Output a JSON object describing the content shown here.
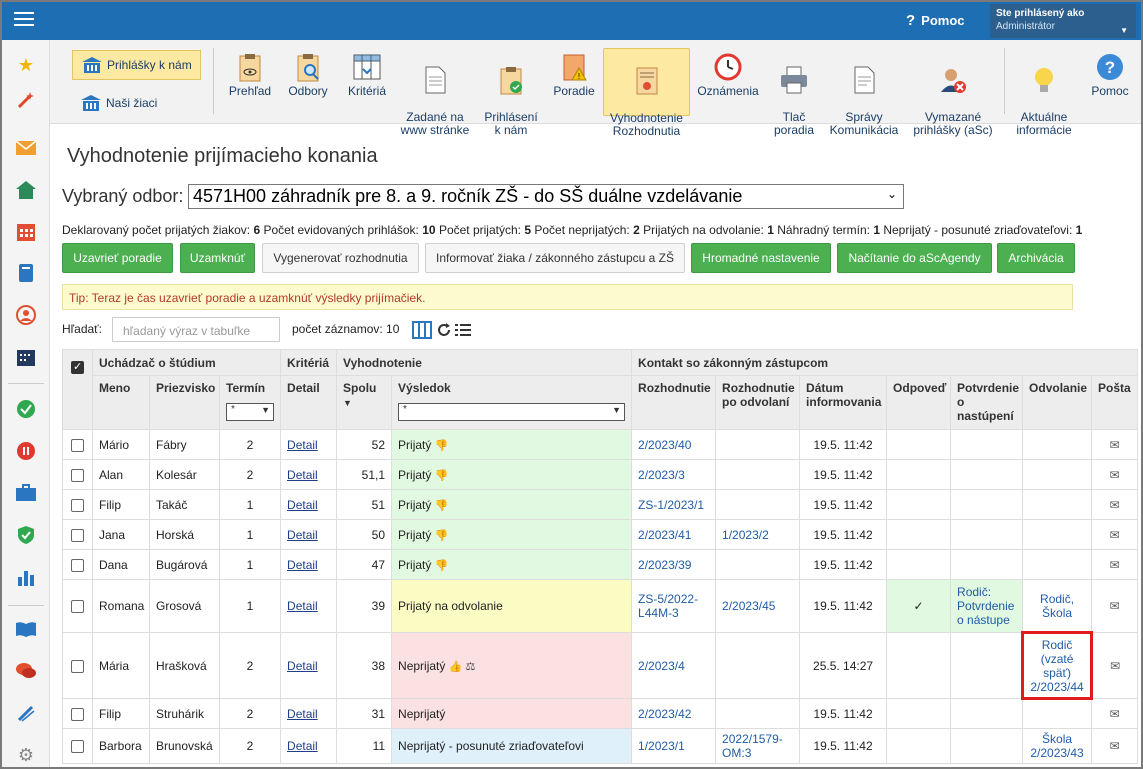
{
  "topbar": {
    "help_label": "Pomoc",
    "user_line1": "Ste prihlásený ako",
    "user_line2": "Administrátor"
  },
  "sidebar": {
    "icons": [
      "star-icon",
      "magic-wand-icon",
      "envelope-icon",
      "home-icon",
      "calendar-icon",
      "book-icon",
      "person-icon",
      "timetable-icon",
      "checkmark-icon",
      "pause-icon",
      "briefcase-icon",
      "shield-icon",
      "chart-icon",
      "open-book-icon",
      "chat-icon",
      "pen-icon",
      "gear-icon"
    ]
  },
  "toolbar": {
    "left": [
      {
        "label": "Prihlášky k nám",
        "active": true
      },
      {
        "label": "Naši žiaci",
        "active": false
      }
    ],
    "items": [
      {
        "label": "Prehľad",
        "icon": "clipboard-eye-icon"
      },
      {
        "label": "Odbory",
        "icon": "clipboard-search-icon"
      },
      {
        "label": "Kritériá",
        "icon": "table-download-icon"
      },
      {
        "label": "Zadané na\nwww stránke",
        "icon": "document-icon"
      },
      {
        "label": "Prihlásení\nk nám",
        "icon": "clipboard-check-icon"
      },
      {
        "label": "Poradie",
        "icon": "warning-doc-icon"
      },
      {
        "label": "Vyhodnotenie\nRozhodnutia",
        "icon": "certificate-icon",
        "active": true
      },
      {
        "label": "Oznámenia",
        "icon": "clock-icon"
      },
      {
        "label": "Tlač\nporadia",
        "icon": "printer-icon"
      },
      {
        "label": "Správy\nKomunikácia",
        "icon": "message-doc-icon"
      },
      {
        "label": "Vymazané\nprihlášky (aSc)",
        "icon": "user-delete-icon"
      },
      {
        "label": "Aktuálne\ninformácie",
        "icon": "lightbulb-icon"
      },
      {
        "label": "Pomoc",
        "icon": "help-icon"
      }
    ]
  },
  "page": {
    "title": "Vyhodnotenie prijímacieho konania",
    "odbor_label": "Vybraný odbor:",
    "odbor_value": "4571H00 záhradník pre 8. a 9. ročník ZŠ - do SŠ duálne vzdelávanie",
    "stats": [
      {
        "label": "Deklarovaný počet prijatých žiakov:",
        "value": "6"
      },
      {
        "label": "Počet evidovaných prihlášok:",
        "value": "10"
      },
      {
        "label": "Počet prijatých:",
        "value": "5"
      },
      {
        "label": "Počet neprijatých:",
        "value": "2"
      },
      {
        "label": "Prijatých na odvolanie:",
        "value": "1"
      },
      {
        "label": "Náhradný termín:",
        "value": "1"
      },
      {
        "label": "Neprijatý - posunuté zriaďovateľovi:",
        "value": "1"
      }
    ],
    "buttons": [
      {
        "label": "Uzavrieť poradie",
        "style": "green"
      },
      {
        "label": "Uzamknúť",
        "style": "green"
      },
      {
        "label": "Vygenerovať rozhodnutia",
        "style": "gray"
      },
      {
        "label": "Informovať žiaka / zákonného zástupcu a ZŠ",
        "style": "gray"
      },
      {
        "label": "Hromadné nastavenie",
        "style": "green"
      },
      {
        "label": "Načítanie do aScAgendy",
        "style": "green"
      },
      {
        "label": "Archivácia",
        "style": "green"
      }
    ],
    "tip": "Tip: Teraz je čas uzavrieť poradie a uzamknúť výsledky prijímačiek.",
    "search_label": "Hľadať:",
    "search_placeholder": "hľadaný výraz v tabuľke",
    "count_label": "počet záznamov: 10"
  },
  "table": {
    "groups": {
      "applicant": "Uchádzač o štúdium",
      "criteria": "Kritériá",
      "evaluation": "Vyhodnotenie",
      "contact": "Kontakt so zákonným zástupcom"
    },
    "columns": {
      "meno": "Meno",
      "priezvisko": "Priezvisko",
      "termin": "Termín",
      "detail": "Detail",
      "spolu": "Spolu",
      "vysledok": "Výsledok",
      "rozhodnutie": "Rozhodnutie",
      "rozhodnutie_odv": "Rozhodnutie po odvolaní",
      "datum": "Dátum informovania",
      "odpoved": "Odpoveď",
      "potvrdenie": "Potvrdenie o nastúpení",
      "odvolanie": "Odvolanie",
      "posta": "Pošta"
    },
    "filter_termin": "*",
    "filter_vysledok": "*",
    "sort_indicator": "▼",
    "rows": [
      {
        "meno": "Mário",
        "priezvisko": "Fábry",
        "termin": "2",
        "detail": "Detail",
        "spolu": "52",
        "vysledok": "Prijatý",
        "thumbs": "👎",
        "rbg": "green",
        "rozhodnutie": "2/2023/40",
        "rozhodnutie_odv": "",
        "datum": "19.5. 11:42",
        "odpoved": "",
        "potvrdenie": "",
        "odvolanie": ""
      },
      {
        "meno": "Alan",
        "priezvisko": "Kolesár",
        "termin": "2",
        "detail": "Detail",
        "spolu": "51,1",
        "vysledok": "Prijatý",
        "thumbs": "👎",
        "rbg": "green",
        "rozhodnutie": "2/2023/3",
        "rozhodnutie_odv": "",
        "datum": "19.5. 11:42",
        "odpoved": "",
        "potvrdenie": "",
        "odvolanie": ""
      },
      {
        "meno": "Filip",
        "priezvisko": "Takáč",
        "termin": "1",
        "detail": "Detail",
        "spolu": "51",
        "vysledok": "Prijatý",
        "thumbs": "👎",
        "rbg": "green",
        "rozhodnutie": "ZS-1/2023/1",
        "rozhodnutie_odv": "",
        "datum": "19.5. 11:42",
        "odpoved": "",
        "potvrdenie": "",
        "odvolanie": ""
      },
      {
        "meno": "Jana",
        "priezvisko": "Horská",
        "termin": "1",
        "detail": "Detail",
        "spolu": "50",
        "vysledok": "Prijatý",
        "thumbs": "👎",
        "rbg": "green",
        "rozhodnutie": "2/2023/41",
        "rozhodnutie_odv": "1/2023/2",
        "datum": "19.5. 11:42",
        "odpoved": "",
        "potvrdenie": "",
        "odvolanie": ""
      },
      {
        "meno": "Dana",
        "priezvisko": "Bugárová",
        "termin": "1",
        "detail": "Detail",
        "spolu": "47",
        "vysledok": "Prijatý",
        "thumbs": "👎",
        "rbg": "green",
        "rozhodnutie": "2/2023/39",
        "rozhodnutie_odv": "",
        "datum": "19.5. 11:42",
        "odpoved": "",
        "potvrdenie": "",
        "odvolanie": ""
      },
      {
        "meno": "Romana",
        "priezvisko": "Grosová",
        "termin": "1",
        "detail": "Detail",
        "spolu": "39",
        "vysledok": "Prijatý na odvolanie",
        "thumbs": "",
        "rbg": "yellow",
        "rozhodnutie": "ZS-5/2022-L44M-3",
        "rozhodnutie_odv": "2/2023/45",
        "datum": "19.5. 11:42",
        "odpoved": "✓",
        "potvrdenie": "Rodič: Potvrdenie o nástupe",
        "odvolanie": "Rodič, Škola"
      },
      {
        "meno": "Mária",
        "priezvisko": "Hrašková",
        "termin": "2",
        "detail": "Detail",
        "spolu": "38",
        "vysledok": "Neprijatý",
        "thumbs": "👍 ⚖",
        "rbg": "red",
        "rozhodnutie": "2/2023/4",
        "rozhodnutie_odv": "",
        "datum": "25.5. 14:27",
        "odpoved": "",
        "potvrdenie": "",
        "odvolanie": "Rodič (vzaté späť) 2/2023/44"
      },
      {
        "meno": "Filip",
        "priezvisko": "Struhárik",
        "termin": "2",
        "detail": "Detail",
        "spolu": "31",
        "vysledok": "Neprijatý",
        "thumbs": "",
        "rbg": "red",
        "rozhodnutie": "2/2023/42",
        "rozhodnutie_odv": "",
        "datum": "19.5. 11:42",
        "odpoved": "",
        "potvrdenie": "",
        "odvolanie": ""
      },
      {
        "meno": "Barbora",
        "priezvisko": "Brunovská",
        "termin": "2",
        "detail": "Detail",
        "spolu": "11",
        "vysledok": "Neprijatý - posunuté zriaďovateľovi",
        "thumbs": "",
        "rbg": "blue",
        "rozhodnutie": "1/2023/1",
        "rozhodnutie_odv": "2022/1579-OM:3",
        "datum": "19.5. 11:42",
        "odpoved": "",
        "potvrdenie": "",
        "odvolanie": "Škola 2/2023/43"
      }
    ]
  }
}
